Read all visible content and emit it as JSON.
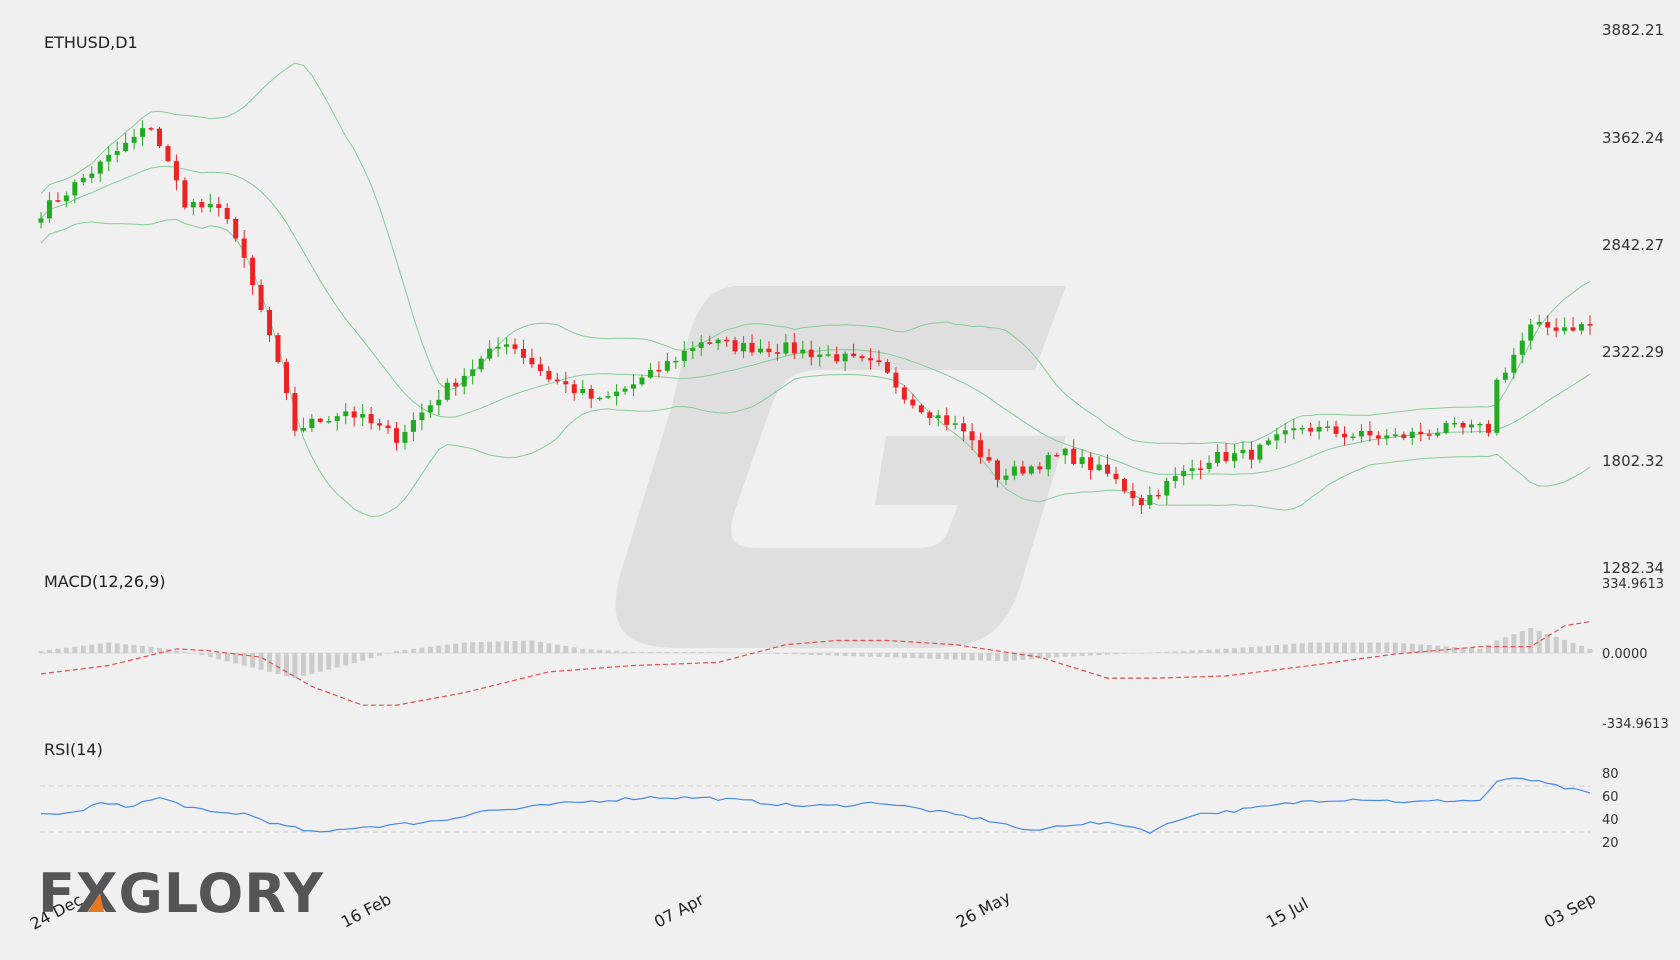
{
  "chart_data": {
    "type": "candlestick",
    "title": "ETHUSD,D1",
    "x_labels": [
      "24 Dec",
      "16 Feb",
      "07 Apr",
      "26 May",
      "15 Jul",
      "03 Sep"
    ],
    "price_axis": {
      "ticks": [
        "3882.21",
        "3362.24",
        "2842.27",
        "2322.29",
        "1802.32",
        "1282.34"
      ],
      "range": [
        1282.34,
        3882.21
      ]
    },
    "close_anchors": [
      [
        0,
        3000
      ],
      [
        7,
        3230
      ],
      [
        13,
        3420
      ],
      [
        17,
        3050
      ],
      [
        22,
        2990
      ],
      [
        27,
        2400
      ],
      [
        30,
        1950
      ],
      [
        36,
        2040
      ],
      [
        42,
        1910
      ],
      [
        48,
        2150
      ],
      [
        55,
        2380
      ],
      [
        60,
        2200
      ],
      [
        66,
        2080
      ],
      [
        72,
        2210
      ],
      [
        78,
        2380
      ],
      [
        82,
        2350
      ],
      [
        88,
        2340
      ],
      [
        94,
        2300
      ],
      [
        99,
        2250
      ],
      [
        103,
        2080
      ],
      [
        109,
        1940
      ],
      [
        113,
        1720
      ],
      [
        117,
        1770
      ],
      [
        121,
        1830
      ],
      [
        126,
        1730
      ],
      [
        130,
        1600
      ],
      [
        134,
        1710
      ],
      [
        138,
        1810
      ],
      [
        143,
        1830
      ],
      [
        149,
        1960
      ],
      [
        155,
        1920
      ],
      [
        160,
        1910
      ],
      [
        166,
        1950
      ],
      [
        171,
        1950
      ],
      [
        172,
        2180
      ],
      [
        176,
        2440
      ],
      [
        183,
        2450
      ]
    ],
    "panels": [
      {
        "name": "MACD(12,26,9)",
        "axis_ticks": [
          "334.9613",
          "0.0000",
          "-334.9613"
        ],
        "range": [
          -334.9613,
          334.9613
        ],
        "series": [
          {
            "name": "MACD histogram",
            "type": "bar",
            "color": "#cccccc",
            "anchors": [
              [
                0,
                10
              ],
              [
                8,
                50
              ],
              [
                13,
                30
              ],
              [
                18,
                0
              ],
              [
                22,
                -40
              ],
              [
                30,
                -120
              ],
              [
                36,
                -60
              ],
              [
                42,
                10
              ],
              [
                50,
                50
              ],
              [
                58,
                60
              ],
              [
                64,
                20
              ],
              [
                70,
                5
              ],
              [
                78,
                5
              ],
              [
                88,
                -5
              ],
              [
                100,
                -20
              ],
              [
                114,
                -40
              ],
              [
                120,
                -20
              ],
              [
                130,
                0
              ],
              [
                140,
                20
              ],
              [
                150,
                50
              ],
              [
                160,
                50
              ],
              [
                170,
                20
              ],
              [
                172,
                60
              ],
              [
                176,
                120
              ],
              [
                183,
                20
              ]
            ]
          },
          {
            "name": "Signal",
            "type": "dashed-line",
            "color": "#e05050",
            "anchors": [
              [
                0,
                -100
              ],
              [
                8,
                -60
              ],
              [
                16,
                20
              ],
              [
                20,
                10
              ],
              [
                26,
                -20
              ],
              [
                32,
                -160
              ],
              [
                38,
                -250
              ],
              [
                42,
                -250
              ],
              [
                50,
                -190
              ],
              [
                60,
                -90
              ],
              [
                70,
                -60
              ],
              [
                80,
                -45
              ],
              [
                88,
                40
              ],
              [
                94,
                60
              ],
              [
                100,
                60
              ],
              [
                108,
                40
              ],
              [
                118,
                -20
              ],
              [
                126,
                -120
              ],
              [
                132,
                -120
              ],
              [
                140,
                -110
              ],
              [
                150,
                -60
              ],
              [
                160,
                -5
              ],
              [
                170,
                30
              ],
              [
                176,
                30
              ],
              [
                180,
                130
              ],
              [
                183,
                150
              ]
            ]
          }
        ]
      },
      {
        "name": "RSI(14)",
        "axis_ticks": [
          "80",
          "60",
          "40",
          "20"
        ],
        "range": [
          20,
          80
        ],
        "levels": [
          70,
          30
        ],
        "series": [
          {
            "name": "RSI",
            "type": "line",
            "color": "#4488ee",
            "anchors": [
              [
                0,
                42
              ],
              [
                4,
                44
              ],
              [
                7,
                55
              ],
              [
                10,
                51
              ],
              [
                14,
                61
              ],
              [
                17,
                52
              ],
              [
                20,
                44
              ],
              [
                24,
                43
              ],
              [
                28,
                30
              ],
              [
                33,
                20
              ],
              [
                36,
                26
              ],
              [
                42,
                30
              ],
              [
                48,
                36
              ],
              [
                52,
                46
              ],
              [
                56,
                48
              ],
              [
                60,
                53
              ],
              [
                66,
                58
              ],
              [
                72,
                62
              ],
              [
                79,
                61
              ],
              [
                84,
                57
              ],
              [
                89,
                52
              ],
              [
                94,
                52
              ],
              [
                99,
                56
              ],
              [
                104,
                48
              ],
              [
                109,
                40
              ],
              [
                113,
                33
              ],
              [
                117,
                22
              ],
              [
                121,
                30
              ],
              [
                124,
                32
              ],
              [
                128,
                30
              ],
              [
                131,
                22
              ],
              [
                136,
                42
              ],
              [
                140,
                45
              ],
              [
                144,
                50
              ],
              [
                150,
                58
              ],
              [
                156,
                60
              ],
              [
                162,
                56
              ],
              [
                166,
                58
              ],
              [
                170,
                58
              ],
              [
                172,
                80
              ],
              [
                175,
                84
              ],
              [
                178,
                77
              ],
              [
                183,
                66
              ]
            ]
          }
        ]
      }
    ],
    "indicators": [
      "Bollinger Bands"
    ]
  },
  "watermark": {
    "logo": "G"
  },
  "branding": {
    "logo_text": "FXGLORY",
    "accent_color": "#e87722"
  },
  "colors": {
    "background": "#f0f0f0",
    "up": "#22aa22",
    "down": "#ee2222",
    "bands": "#88cc99",
    "macd_signal": "#e05050",
    "rsi_line": "#4488ee",
    "grid": "#cccccc"
  }
}
